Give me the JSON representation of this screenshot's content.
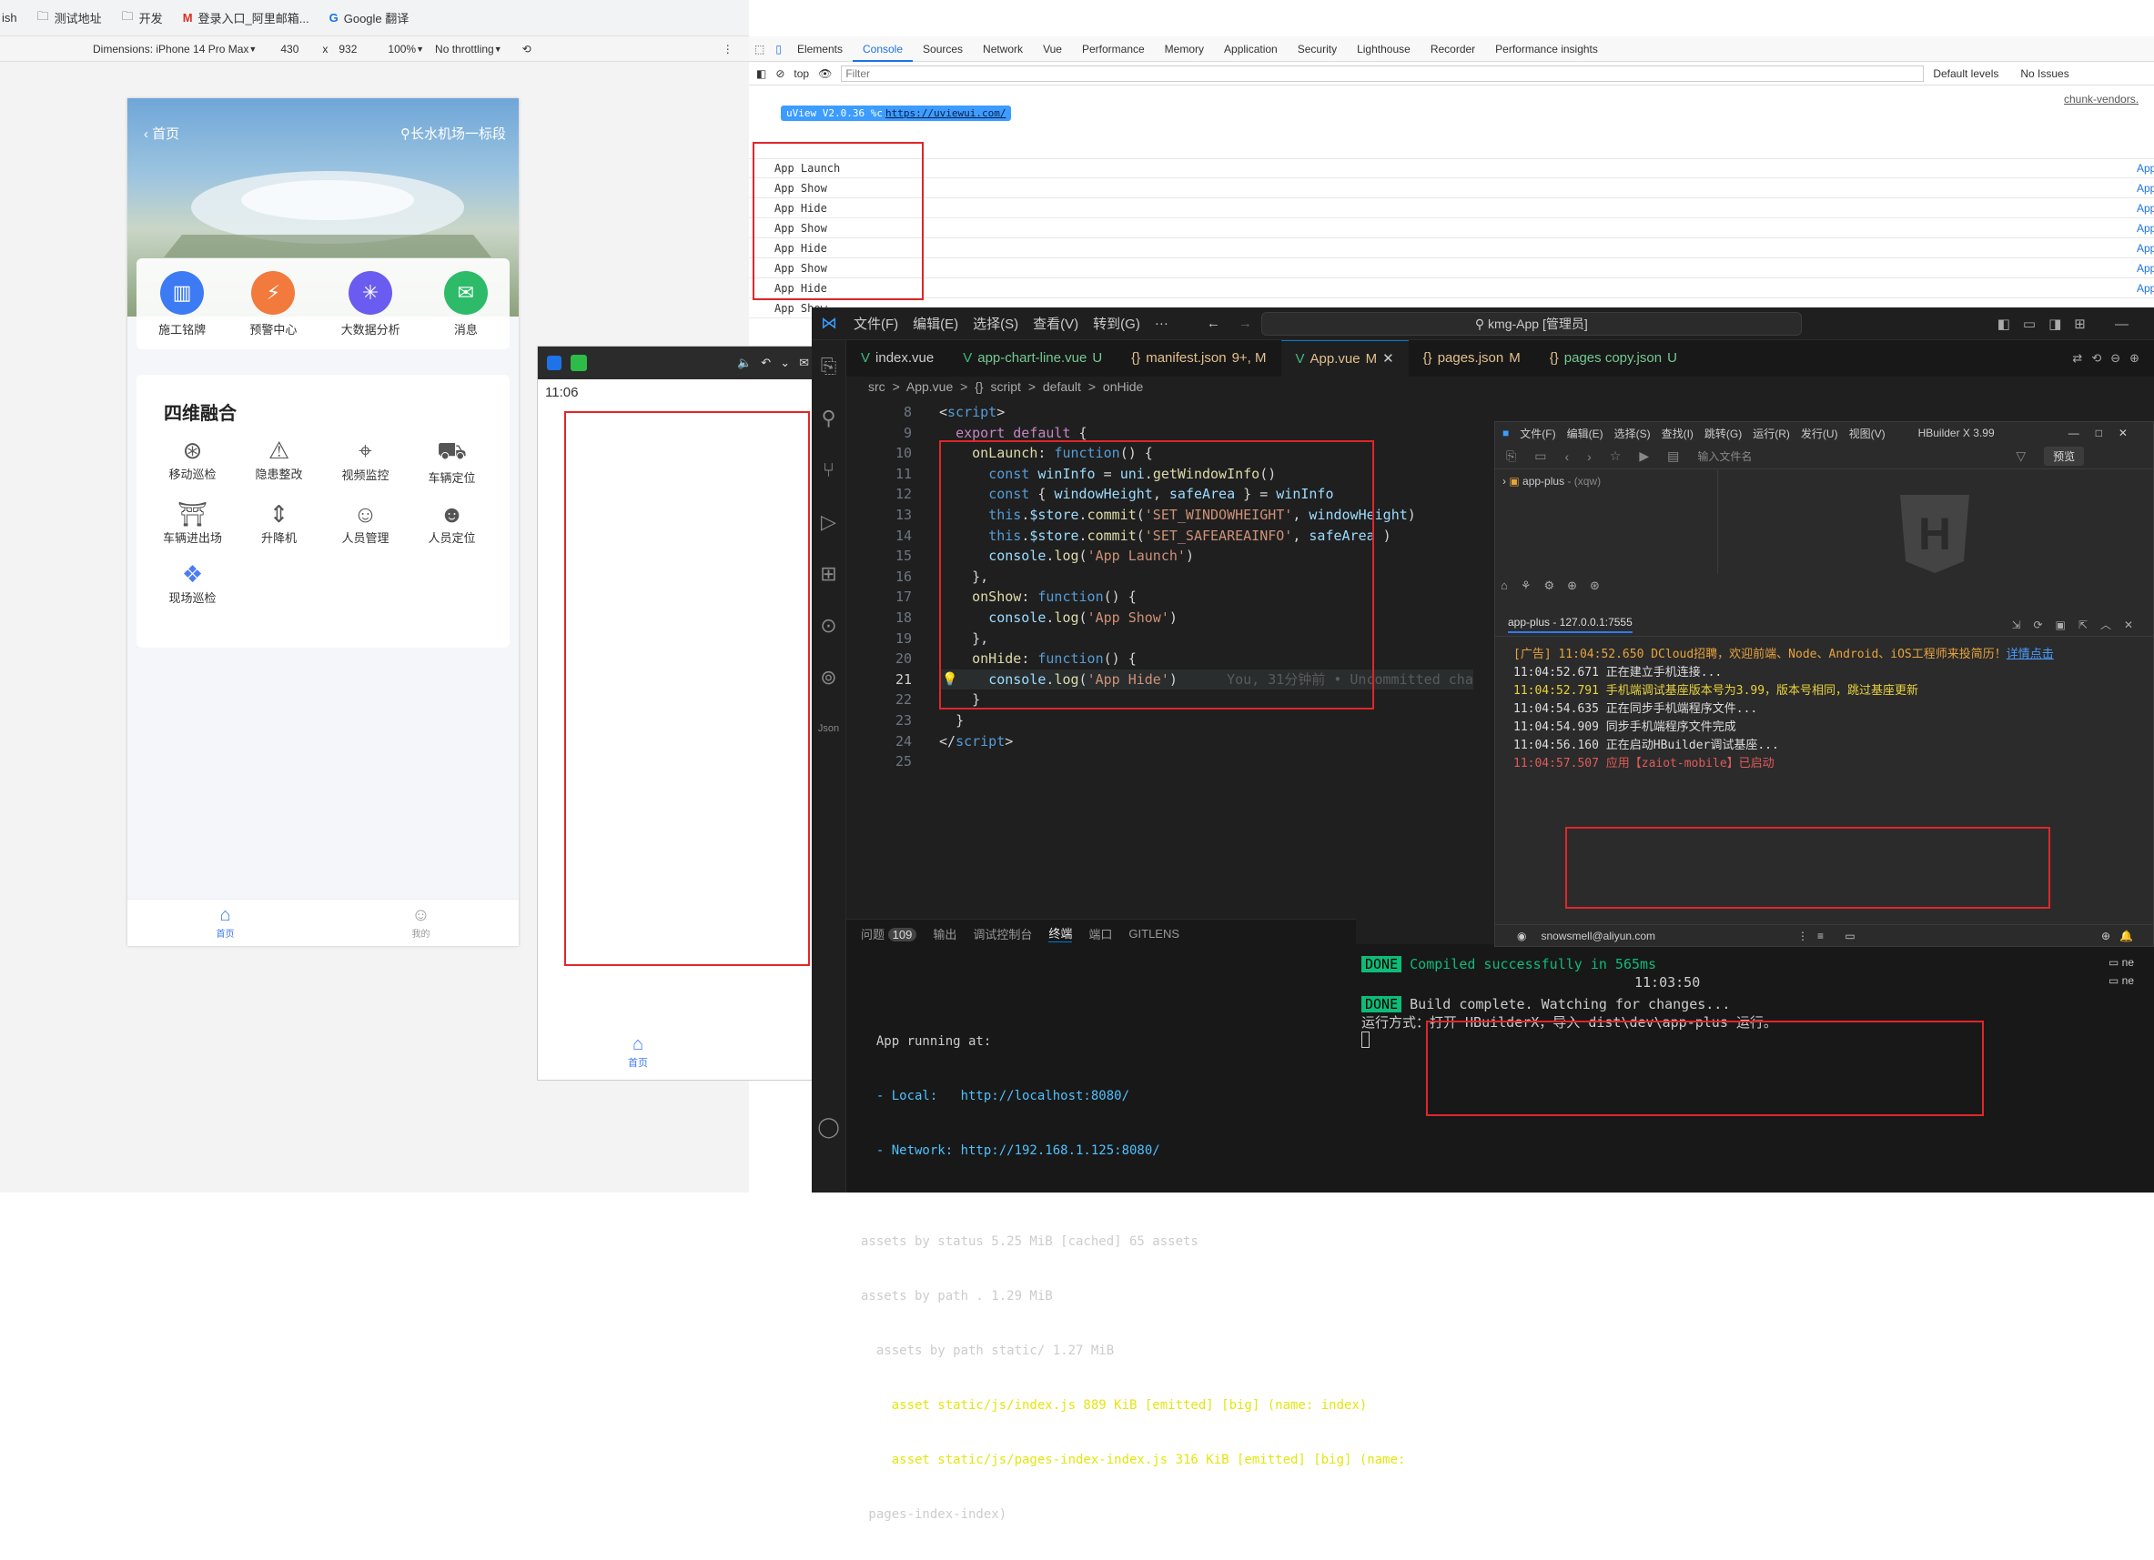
{
  "bookmarks": [
    "ish",
    "测试地址",
    "开发",
    "登录入口_阿里邮箱...",
    "Google 翻译"
  ],
  "emulator": {
    "dimensions": "Dimensions: iPhone 14 Pro Max",
    "width": "430",
    "x": "x",
    "height": "932",
    "zoom": "100%",
    "throttle": "No throttling"
  },
  "phone": {
    "back": "首页",
    "location": "长水机场一标段",
    "icons": [
      "施工铭牌",
      "预警中心",
      "大数据分析",
      "消息"
    ],
    "section_title": "四维融合",
    "grid": [
      "移动巡检",
      "隐患整改",
      "视频监控",
      "车辆定位",
      "车辆进出场",
      "升降机",
      "人员管理",
      "人员定位",
      "现场巡检"
    ],
    "tabs": [
      "首页",
      "我的"
    ]
  },
  "phone2": {
    "time": "11:06",
    "tab": "首页"
  },
  "devtools": {
    "tabs": [
      "Elements",
      "Console",
      "Sources",
      "Network",
      "Vue",
      "Performance",
      "Memory",
      "Application",
      "Security",
      "Lighthouse",
      "Recorder",
      "Performance insights"
    ],
    "active": "Console",
    "context": "top",
    "filter_placeholder": "Filter",
    "levels": "Default levels",
    "issues": "No Issues",
    "chunk": "chunk-vendors.",
    "uview": "uView V2.0.36 %c",
    "uview_link": "https://uviewui.com/",
    "logs": [
      "App Launch",
      "App Show",
      "App Hide",
      "App Show",
      "App Hide",
      "App Show",
      "App Hide",
      "App Show"
    ],
    "src": "App"
  },
  "vscode": {
    "menu": [
      "文件(F)",
      "编辑(E)",
      "选择(S)",
      "查看(V)",
      "转到(G)",
      "···"
    ],
    "search": "kmg-App [管理员]",
    "tabs": [
      {
        "name": "index.vue",
        "mod": ""
      },
      {
        "name": "app-chart-line.vue",
        "mod": "U"
      },
      {
        "name": "manifest.json",
        "mod": "9+, M"
      },
      {
        "name": "App.vue",
        "mod": "M"
      },
      {
        "name": "pages.json",
        "mod": "M"
      },
      {
        "name": "pages copy.json",
        "mod": "U"
      }
    ],
    "breadcrumb": [
      "src",
      ">",
      "App.vue",
      ">",
      "{} script",
      ">",
      "default",
      ">",
      "onHide"
    ],
    "line_numbers": [
      "8",
      "9",
      "10",
      "11",
      "12",
      "13",
      "14",
      "15",
      "16",
      "17",
      "18",
      "19",
      "20",
      "21",
      "22",
      "23",
      "24",
      "25"
    ],
    "blame": "You, 31分钟前 • Uncommitted cha",
    "panel_tabs": [
      "问题",
      "输出",
      "调试控制台",
      "终端",
      "端口",
      "GITLENS"
    ],
    "problems_count": "109",
    "active_panel": "终端",
    "terminal": [
      "",
      "  App running at:",
      "  - Local:   http://localhost:8080/",
      "  - Network: http://192.168.1.125:8080/",
      "",
      "assets by status 5.25 MiB [cached] 65 assets",
      "assets by path . 1.29 MiB",
      "  assets by path static/ 1.27 MiB",
      "    asset static/js/index.js 889 KiB [emitted] [big] (name: index)",
      "    asset static/js/pages-index-index.js 316 KiB [emitted] [big] (name:",
      " pages-index-index)"
    ],
    "term2_done1": "DONE",
    "term2_msg1": "Compiled successfully in 565ms",
    "term2_time": "11:03:50",
    "term2_done2": "DONE",
    "term2_msg2": "Build complete. Watching for changes...",
    "term2_msg3": "运行方式：打开 HBuilderX，导入 dist\\dev\\app-plus 运行。"
  },
  "hbuilder": {
    "menu": [
      "文件(F)",
      "编辑(E)",
      "选择(S)",
      "查找(I)",
      "跳转(G)",
      "运行(R)",
      "发行(U)",
      "视图(V)"
    ],
    "title": "HBuilder X 3.99",
    "input": "输入文件名",
    "preview": "预览",
    "project": "app-plus",
    "project_sub": "- (xqw)",
    "console_tab": "app-plus - 127.0.0.1:7555",
    "account": "snowsmell@aliyun.com",
    "logs": [
      {
        "t": "[广告] 11:04:52.650 DCloud招聘，欢迎前端、Node、Android、iOS工程师来投简历！",
        "link": "详情点击",
        "c": "#e8a33c"
      },
      {
        "t": "11:04:52.671 正在建立手机连接...",
        "c": "#ddd"
      },
      {
        "t": "11:04:52.791 手机端调试基座版本号为3.99，版本号相同，跳过基座更新",
        "c": "#e8d23c"
      },
      {
        "t": "11:04:54.635 正在同步手机端程序文件...",
        "c": "#ddd"
      },
      {
        "t": "11:04:54.909 同步手机端程序文件完成",
        "c": "#ddd"
      },
      {
        "t": "11:04:56.160 正在启动HBuilder调试基座...",
        "c": "#ddd"
      },
      {
        "t": "11:04:57.507 应用【zaiot-mobile】已启动",
        "c": "#e05a5a"
      }
    ]
  }
}
